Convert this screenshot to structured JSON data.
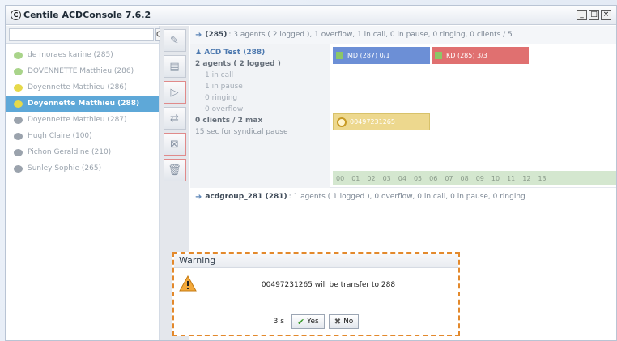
{
  "window": {
    "logo": "C",
    "title": "Centile ACDConsole 7.6.2",
    "controls": [
      "_",
      "□",
      "×"
    ]
  },
  "search": {
    "placeholder": ""
  },
  "agents": [
    {
      "label": "de moraes karine (285)",
      "status": "green",
      "selected": false
    },
    {
      "label": "DOVENNETTE Matthieu (286)",
      "status": "green",
      "selected": false
    },
    {
      "label": "Doyennette Matthieu (286)",
      "status": "yellow",
      "selected": false
    },
    {
      "label": "Doyennette Matthieu (288)",
      "status": "yellow",
      "selected": true
    },
    {
      "label": "Doyennette Matthieu (287)",
      "status": "gray",
      "selected": false
    },
    {
      "label": "Hugh Claire (100)",
      "status": "gray",
      "selected": false
    },
    {
      "label": "Pichon Geraldine (210)",
      "status": "gray",
      "selected": false
    },
    {
      "label": "Sunley Sophie (265)",
      "status": "gray",
      "selected": false
    }
  ],
  "toolbar": [
    "edit-icon",
    "list-icon",
    "play-icon",
    "transfer-icon",
    "remove-icon",
    "trash-icon"
  ],
  "group1": {
    "id": "(285)",
    "summary": ": 3 agents ( 2 logged ), 1 overflow, 1 in call, 0 in pause, 0 ringing, 0 clients / 5"
  },
  "acd": {
    "name": "ACD Test (288)",
    "agents": "2 agents ( 2 logged )",
    "lines": [
      "1 in call",
      "1 in pause",
      "0 ringing",
      "0 overflow"
    ],
    "clients": "0 clients / 2 max",
    "pause": "15 sec for syndical pause"
  },
  "chips": [
    {
      "label": "MD (287)  0/1",
      "color": "#6c8fd6"
    },
    {
      "label": "KD (285)  3/3",
      "color": "#e07070"
    }
  ],
  "client_chip": "00497231265",
  "timeline": [
    "00",
    "01",
    "02",
    "03",
    "04",
    "05",
    "06",
    "07",
    "08",
    "09",
    "10",
    "11",
    "12",
    "13"
  ],
  "group2": {
    "id": "acdgroup_281 (281)",
    "summary": ": 1 agents ( 1 logged ), 0 overflow, 0 in call, 0 in pause, 0 ringing"
  },
  "dialog": {
    "title": "Warning",
    "message": "00497231265 will be transfer to 288",
    "countdown": "3 s",
    "yes_label": "Yes",
    "no_label": "No"
  }
}
